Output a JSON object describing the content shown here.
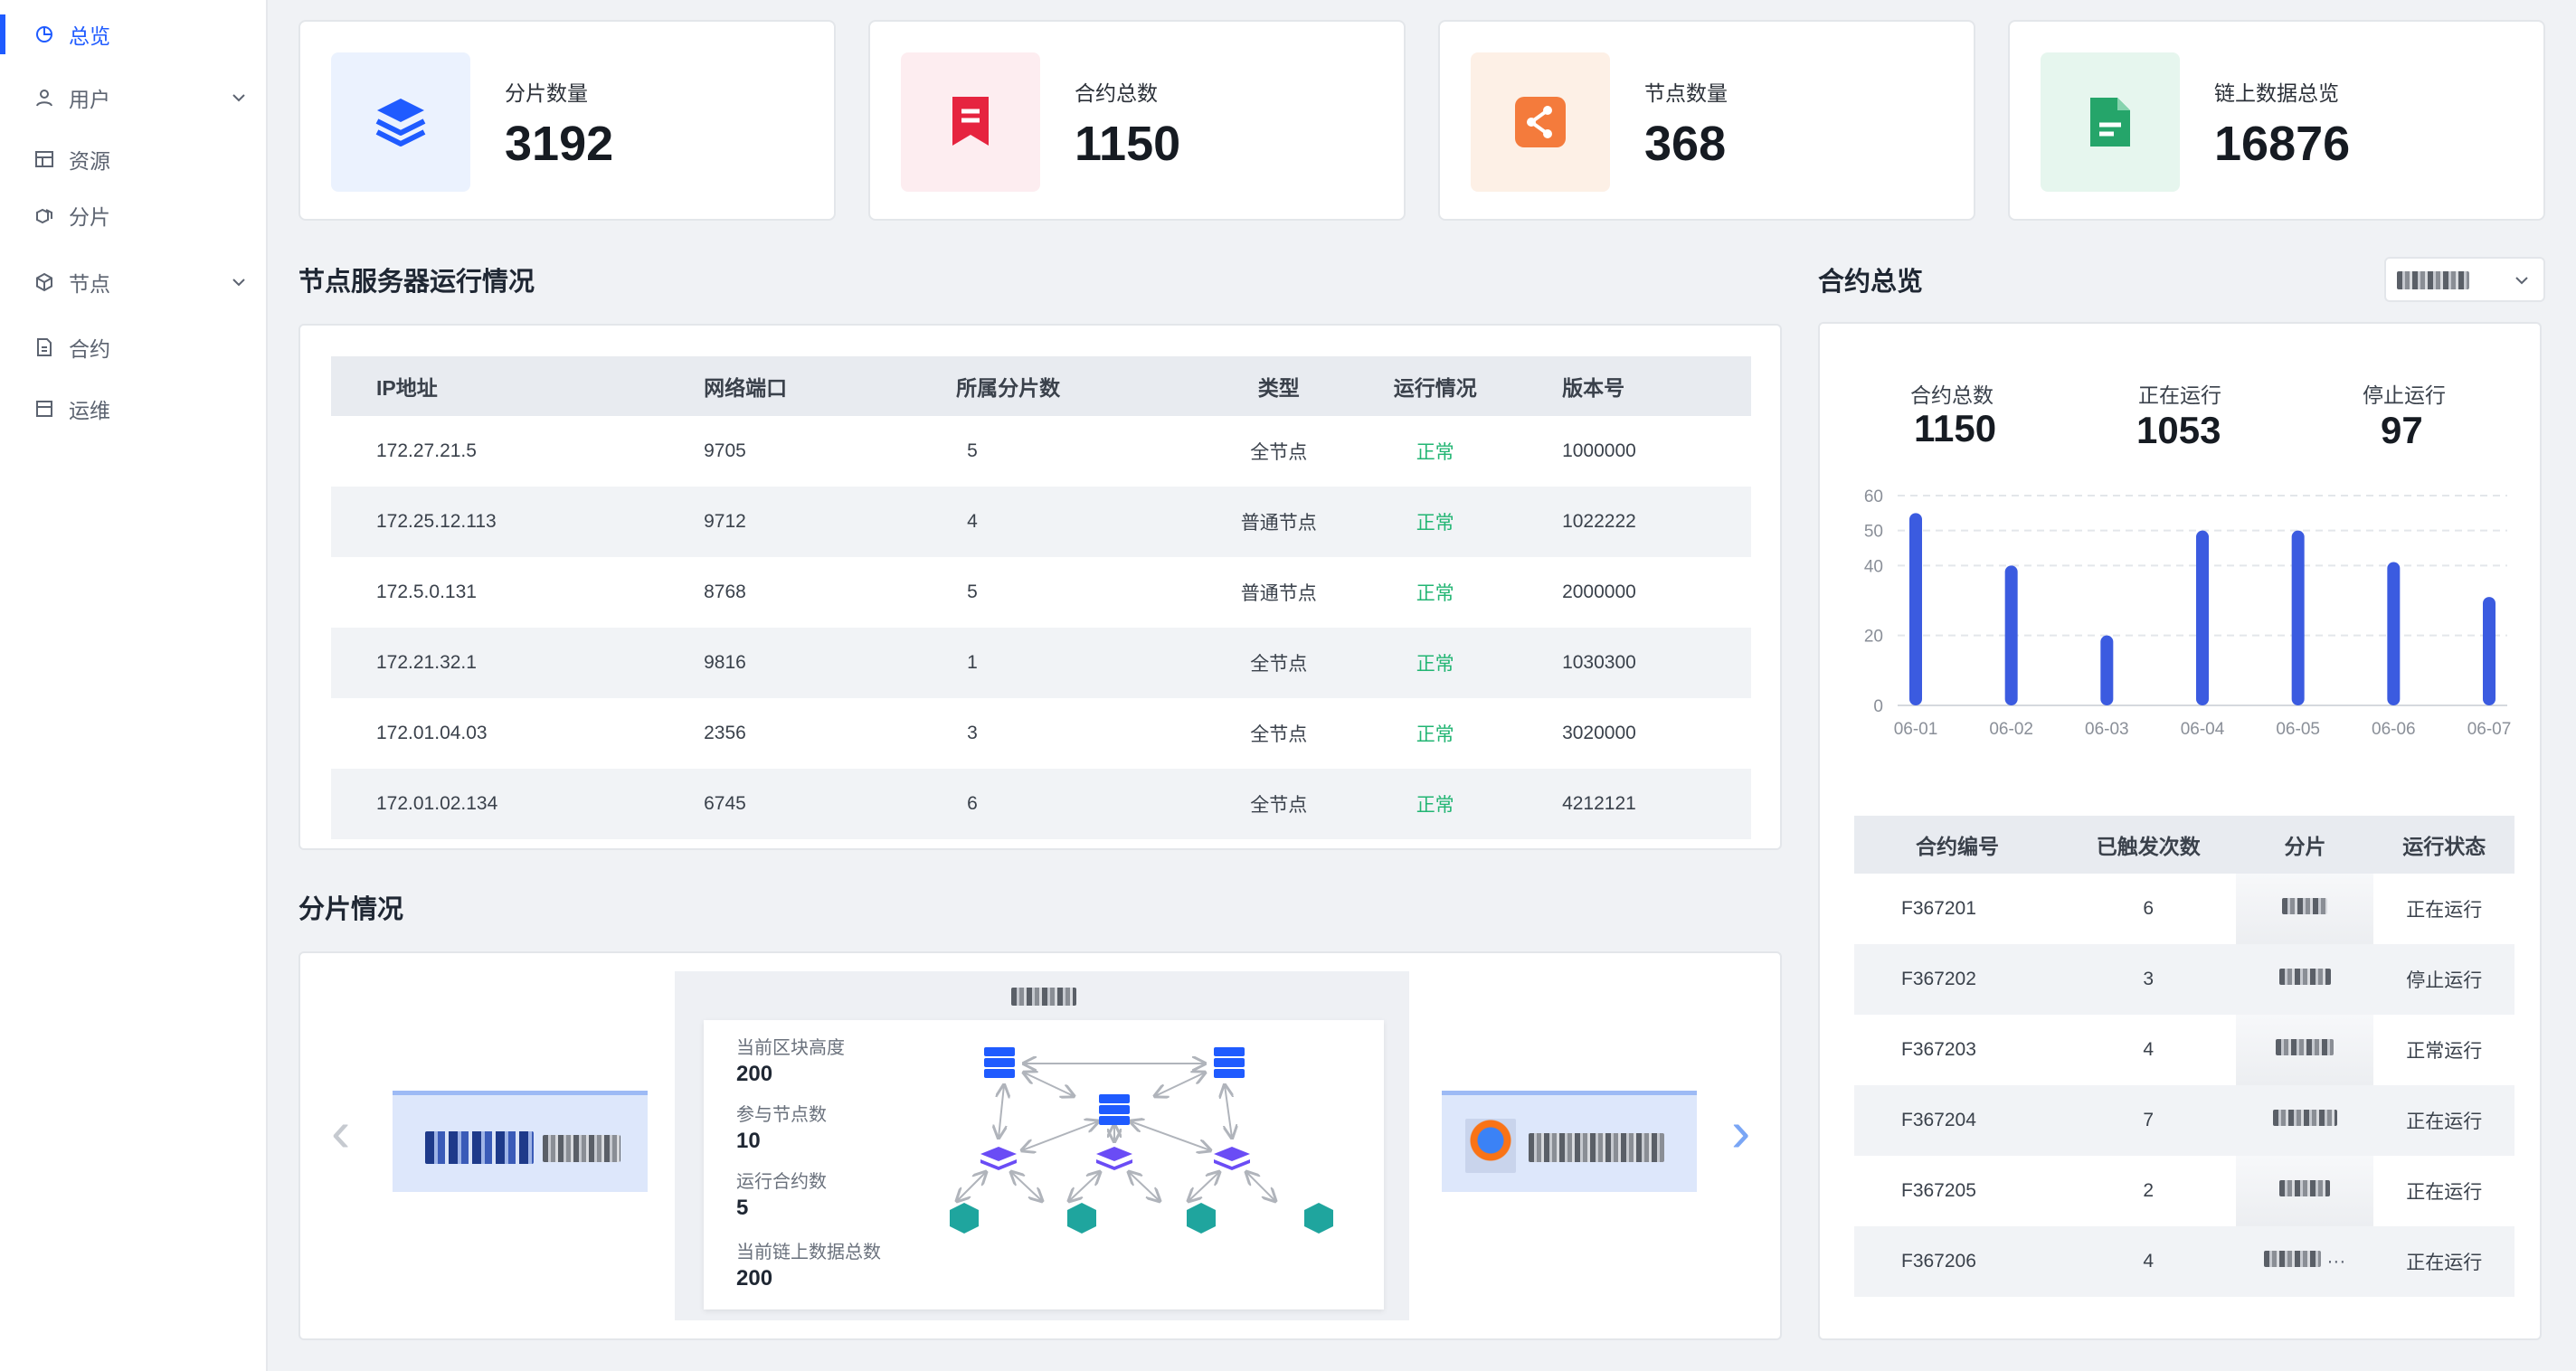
{
  "sidebar": {
    "items": [
      {
        "label": "总览",
        "icon": "dashboard-pie-icon",
        "active": true
      },
      {
        "label": "用户",
        "icon": "user-icon",
        "expandable": true
      },
      {
        "label": "资源",
        "icon": "resource-table-icon"
      },
      {
        "label": "分片",
        "icon": "shard-cubes-icon"
      },
      {
        "label": "节点",
        "icon": "node-cube-icon",
        "expandable": true
      },
      {
        "label": "合约",
        "icon": "contract-file-icon"
      },
      {
        "label": "运维",
        "icon": "ops-calendar-icon"
      }
    ]
  },
  "stats": [
    {
      "label": "分片数量",
      "value": "3192",
      "icon": "layers-icon",
      "bg": "#ebf2fe",
      "color": "#1f5bff"
    },
    {
      "label": "合约总数",
      "value": "1150",
      "icon": "bookmark-icon",
      "bg": "#fdedf0",
      "color": "#e6243f"
    },
    {
      "label": "节点数量",
      "value": "368",
      "icon": "share-icon",
      "bg": "#fdf0e6",
      "color": "#f47b3c"
    },
    {
      "label": "链上数据总览",
      "value": "16876",
      "icon": "document-icon",
      "bg": "#e6f6ee",
      "color": "#25a56a"
    }
  ],
  "nodes": {
    "title": "节点服务器运行情况",
    "columns": [
      "IP地址",
      "网络端口",
      "所属分片数",
      "类型",
      "运行情况",
      "版本号"
    ],
    "rows": [
      [
        "172.27.21.5",
        "9705",
        "5",
        "全节点",
        "正常",
        "1000000"
      ],
      [
        "172.25.12.113",
        "9712",
        "4",
        "普通节点",
        "正常",
        "1022222"
      ],
      [
        "172.5.0.131",
        "8768",
        "5",
        "普通节点",
        "正常",
        "2000000"
      ],
      [
        "172.21.32.1",
        "9816",
        "1",
        "全节点",
        "正常",
        "1030300"
      ],
      [
        "172.01.04.03",
        "2356",
        "3",
        "全节点",
        "正常",
        "3020000"
      ],
      [
        "172.01.02.134",
        "6745",
        "6",
        "全节点",
        "正常",
        "4212121"
      ]
    ]
  },
  "shards": {
    "title": "分片情况",
    "metrics": [
      {
        "label": "当前区块高度",
        "value": "200"
      },
      {
        "label": "参与节点数",
        "value": "10"
      },
      {
        "label": "运行合约数",
        "value": "5"
      },
      {
        "label": "当前链上数据总数",
        "value": "200"
      }
    ],
    "prev_icon": "chevron-left-icon",
    "next_icon": "chevron-right-icon"
  },
  "contracts": {
    "title": "合约总览",
    "summary": [
      {
        "label": "合约总数",
        "value": "1150"
      },
      {
        "label": "正在运行",
        "value": "1053"
      },
      {
        "label": "停止运行",
        "value": "97"
      }
    ],
    "columns": [
      "合约编号",
      "已触发次数",
      "分片",
      "运行状态"
    ],
    "rows": [
      {
        "id": "F367201",
        "count": "6",
        "status": "正在运行",
        "state": "run"
      },
      {
        "id": "F367202",
        "count": "3",
        "status": "停止运行",
        "state": "stop"
      },
      {
        "id": "F367203",
        "count": "4",
        "status": "正常运行",
        "state": "run"
      },
      {
        "id": "F367204",
        "count": "7",
        "status": "正在运行",
        "state": "run"
      },
      {
        "id": "F367205",
        "count": "2",
        "status": "正在运行",
        "state": "run"
      },
      {
        "id": "F367206",
        "count": "4",
        "status": "正在运行",
        "state": "run",
        "ellipsis": "···"
      }
    ]
  },
  "chart_data": {
    "type": "bar",
    "categories": [
      "06-01",
      "06-02",
      "06-03",
      "06-04",
      "06-05",
      "06-06",
      "06-07"
    ],
    "values": [
      55,
      40,
      20,
      50,
      50,
      41,
      31
    ],
    "yticks": [
      0,
      20,
      40,
      50,
      60
    ],
    "grid": true,
    "color": "#3b5be0"
  },
  "colors": {
    "accent": "#1f5bff",
    "ok": "#22b573",
    "stop": "#e6243f"
  }
}
